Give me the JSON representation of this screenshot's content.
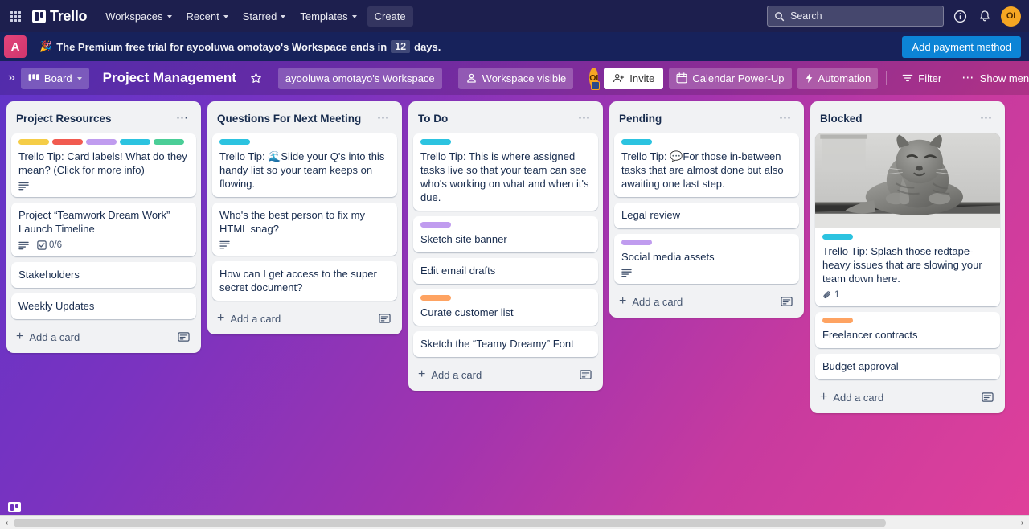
{
  "topnav": {
    "apps_icon": "grid-apps-icon",
    "brand": "Trello",
    "items": [
      {
        "label": "Workspaces",
        "has_caret": true
      },
      {
        "label": "Recent",
        "has_caret": true
      },
      {
        "label": "Starred",
        "has_caret": true
      },
      {
        "label": "Templates",
        "has_caret": true
      },
      {
        "label": "Create",
        "has_caret": false
      }
    ],
    "search": {
      "placeholder": "Search",
      "icon": "search-icon",
      "value": ""
    },
    "info_icon": "info-circle-icon",
    "notifications_icon": "bell-icon",
    "avatar_initials": "OI"
  },
  "banner": {
    "workspace_initial": "A",
    "emoji": "🎉",
    "text_before": "The Premium free trial for ayooluwa omotayo's Workspace ends in",
    "days": "12",
    "text_after": "days.",
    "cta": "Add payment method",
    "cta_color": "#0c84d6"
  },
  "boardbar": {
    "expand_icon": "double-chevron-right-icon",
    "view_button": {
      "label": "Board",
      "icon": "board-view-icon",
      "has_caret": true
    },
    "board_title": "Project Management",
    "star_icon": "star-icon",
    "workspace_name": "ayooluwa omotayo's Workspace",
    "visibility": {
      "label": "Workspace visible",
      "icon": "people-icon"
    },
    "member_initials": "OI",
    "invite": {
      "label": "Invite",
      "icon": "person-add-icon"
    },
    "right_buttons": [
      {
        "label": "Calendar Power-Up",
        "icon": "calendar-icon"
      },
      {
        "label": "Automation",
        "icon": "lightning-icon"
      },
      {
        "label": "Filter",
        "icon": "filter-icon"
      },
      {
        "label": "Show menu",
        "icon": "ellipsis-icon"
      }
    ]
  },
  "board": {
    "add_card_label": "Add a card",
    "card_template_icon": "card-template-icon",
    "list_menu_icon": "ellipsis-icon",
    "label_colors": {
      "yellow": "#f5cd47",
      "red": "#f15b50",
      "purple": "#c09cef",
      "blue": "#2cc3e0",
      "green": "#4bce97",
      "orange": "#fea362"
    },
    "lists": [
      {
        "title": "Project Resources",
        "cards": [
          {
            "title": "Trello Tip: Card labels! What do they mean? (Click for more info)",
            "labels": [
              "yellow",
              "red",
              "purple",
              "blue",
              "green"
            ],
            "badges": [
              {
                "type": "description",
                "icon": "description-icon",
                "text": ""
              }
            ]
          },
          {
            "title": "Project “Teamwork Dream Work” Launch Timeline",
            "labels": [],
            "badges": [
              {
                "type": "description",
                "icon": "description-icon",
                "text": ""
              },
              {
                "type": "checklist",
                "icon": "checklist-icon",
                "text": "0/6"
              }
            ]
          },
          {
            "title": "Stakeholders",
            "labels": [],
            "badges": []
          },
          {
            "title": "Weekly Updates",
            "labels": [],
            "badges": []
          }
        ]
      },
      {
        "title": "Questions For Next Meeting",
        "cards": [
          {
            "title": "Trello Tip: 🌊Slide your Q's into this handy list so your team keeps on flowing.",
            "labels": [
              "blue"
            ],
            "badges": []
          },
          {
            "title": "Who's the best person to fix my HTML snag?",
            "labels": [],
            "badges": [
              {
                "type": "description",
                "icon": "description-icon",
                "text": ""
              }
            ]
          },
          {
            "title": "How can I get access to the super secret document?",
            "labels": [],
            "badges": []
          }
        ]
      },
      {
        "title": "To Do",
        "cards": [
          {
            "title": "Trello Tip: This is where assigned tasks live so that your team can see who's working on what and when it's due.",
            "labels": [
              "blue"
            ],
            "badges": []
          },
          {
            "title": "Sketch site banner",
            "labels": [
              "purple"
            ],
            "badges": []
          },
          {
            "title": "Edit email drafts",
            "labels": [],
            "badges": []
          },
          {
            "title": "Curate customer list",
            "labels": [
              "orange"
            ],
            "badges": []
          },
          {
            "title": "Sketch the “Teamy Dreamy” Font",
            "labels": [],
            "badges": []
          }
        ]
      },
      {
        "title": "Pending",
        "cards": [
          {
            "title": "Trello Tip: 💬For those in-between tasks that are almost done but also awaiting one last step.",
            "labels": [
              "blue"
            ],
            "badges": []
          },
          {
            "title": "Legal review",
            "labels": [],
            "badges": []
          },
          {
            "title": "Social media assets",
            "labels": [
              "purple"
            ],
            "badges": [
              {
                "type": "description",
                "icon": "description-icon",
                "text": ""
              }
            ]
          }
        ]
      },
      {
        "title": "Blocked",
        "cards": [
          {
            "title": "Trello Tip: Splash those redtape-heavy issues that are slowing your team down here.",
            "labels": [
              "blue"
            ],
            "cover": "grayscale-photo-of-sitting-cat",
            "badges": [
              {
                "type": "attachment",
                "icon": "paperclip-icon",
                "text": "1"
              }
            ]
          },
          {
            "title": "Freelancer contracts",
            "labels": [
              "orange"
            ],
            "badges": []
          },
          {
            "title": "Budget approval",
            "labels": [],
            "badges": []
          }
        ]
      }
    ]
  },
  "scrollbar": {
    "left_arrow": "‹",
    "right_arrow": "›"
  }
}
